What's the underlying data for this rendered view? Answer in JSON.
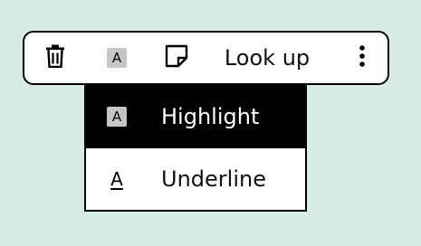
{
  "toolbar": {
    "delete_icon": "trash-icon",
    "highlight_icon": "highlight-a-icon",
    "highlight_glyph": "A",
    "note_icon": "note-icon",
    "lookup_label": "Look up",
    "more_icon": "vertical-ellipsis-icon"
  },
  "menu": {
    "items": [
      {
        "label": "Highlight",
        "icon": "highlight-a-icon",
        "glyph": "A",
        "selected": true
      },
      {
        "label": "Underline",
        "icon": "underline-a-icon",
        "glyph": "A",
        "selected": false
      }
    ]
  },
  "colors": {
    "background": "#d6ede6",
    "toolbar_bg": "#ffffff",
    "border": "#000000",
    "selected_bg": "#000000",
    "selected_text": "#ffffff",
    "highlight_chip": "#c6c6c6"
  }
}
